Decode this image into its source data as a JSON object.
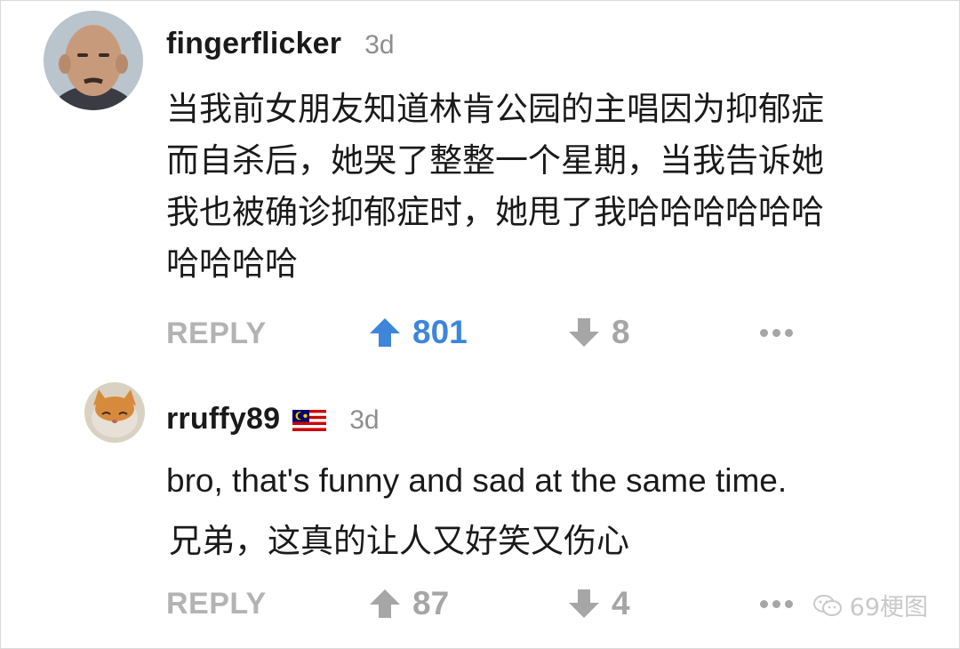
{
  "comments": [
    {
      "author": "fingerflicker",
      "time": "3d",
      "body_lines": [
        "当我前女朋友知道林肯公园的主唱因为抑郁症",
        "而自杀后，她哭了整整一个星期，当我告诉她",
        "我也被确诊抑郁症时，她甩了我哈哈哈哈哈哈",
        "哈哈哈哈"
      ],
      "reply_label": "REPLY",
      "upvotes": "801",
      "downvotes": "8"
    },
    {
      "author": "rruffy89",
      "time": "3d",
      "body_en": "bro, that's funny and sad at the same time.",
      "body_zh": "兄弟，这真的让人又好笑又伤心",
      "reply_label": "REPLY",
      "upvotes": "87",
      "downvotes": "4"
    }
  ],
  "watermark": "69梗图",
  "icons": {
    "upvote_active": "arrow-up-icon",
    "upvote": "arrow-up-icon",
    "downvote": "arrow-down-icon",
    "more": "more-dots-icon",
    "flag": "malaysia-flag-icon",
    "watermark": "wechat-icon"
  },
  "colors": {
    "upvote_active": "#3d86d9",
    "inactive": "#a6a6a6",
    "reply": "#b3b3b3"
  }
}
